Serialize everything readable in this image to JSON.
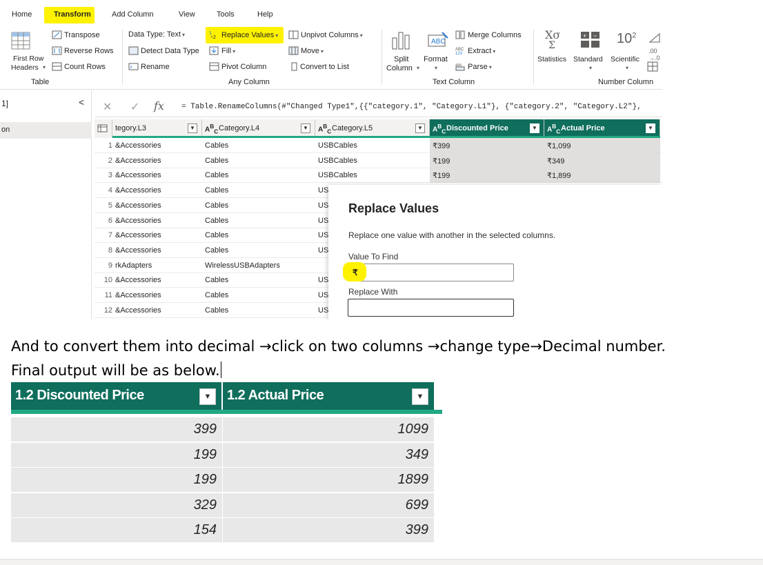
{
  "menu": {
    "home": "Home",
    "transform": "Transform",
    "add_column": "Add Column",
    "view": "View",
    "tools": "Tools",
    "help": "Help"
  },
  "ribbon": {
    "first_row_line1": "First Row",
    "first_row_line2": "Headers",
    "transpose": "Transpose",
    "reverse_rows": "Reverse Rows",
    "count_rows": "Count Rows",
    "data_type": "Data Type: Text",
    "detect_data_type": "Detect Data Type",
    "rename": "Rename",
    "replace_values": "Replace Values",
    "fill": "Fill",
    "pivot_column": "Pivot Column",
    "unpivot_columns": "Unpivot Columns",
    "move": "Move",
    "convert_to_list": "Convert to List",
    "split_line1": "Split",
    "split_line2": "Column",
    "format": "Format",
    "merge_columns": "Merge Columns",
    "extract": "Extract",
    "parse": "Parse",
    "statistics": "Statistics",
    "standard": "Standard",
    "scientific": "Scientific",
    "groups": {
      "table": "Table",
      "any_column": "Any Column",
      "text_column": "Text Column",
      "number_column": "Number Column"
    }
  },
  "queries": {
    "label1": "1]",
    "label2": "on",
    "collapse": "<"
  },
  "formula": {
    "cancel": "✕",
    "commit": "✓",
    "fx": "fx",
    "text": "= Table.RenameColumns(#\"Changed Type1\",{{\"category.1\", \"Category.L1\"}, {\"category.2\", \"Category.L2\"},"
  },
  "grid": {
    "headers": [
      "tegory.L3",
      "Category.L4",
      "Category.L5",
      "Discounted Price",
      "Actual Price"
    ],
    "rows": [
      {
        "n": "1",
        "c3": "&Accessories",
        "c4": "Cables",
        "c5": "USBCables",
        "dp": "₹399",
        "ap": "₹1,099"
      },
      {
        "n": "2",
        "c3": "&Accessories",
        "c4": "Cables",
        "c5": "USBCables",
        "dp": "₹199",
        "ap": "₹349"
      },
      {
        "n": "3",
        "c3": "&Accessories",
        "c4": "Cables",
        "c5": "USBCables",
        "dp": "₹199",
        "ap": "₹1,899"
      },
      {
        "n": "4",
        "c3": "&Accessories",
        "c4": "Cables",
        "c5": "US",
        "dp": "",
        "ap": ""
      },
      {
        "n": "5",
        "c3": "&Accessories",
        "c4": "Cables",
        "c5": "US",
        "dp": "",
        "ap": ""
      },
      {
        "n": "6",
        "c3": "&Accessories",
        "c4": "Cables",
        "c5": "US",
        "dp": "",
        "ap": ""
      },
      {
        "n": "7",
        "c3": "&Accessories",
        "c4": "Cables",
        "c5": "US",
        "dp": "",
        "ap": ""
      },
      {
        "n": "8",
        "c3": "&Accessories",
        "c4": "Cables",
        "c5": "US",
        "dp": "",
        "ap": ""
      },
      {
        "n": "9",
        "c3": "rkAdapters",
        "c4": "WirelessUSBAdapters",
        "c5": "",
        "dp": "",
        "ap": ""
      },
      {
        "n": "10",
        "c3": "&Accessories",
        "c4": "Cables",
        "c5": "US",
        "dp": "",
        "ap": ""
      },
      {
        "n": "11",
        "c3": "&Accessories",
        "c4": "Cables",
        "c5": "US",
        "dp": "",
        "ap": ""
      },
      {
        "n": "12",
        "c3": "&Accessories",
        "c4": "Cables",
        "c5": "US",
        "dp": "",
        "ap": ""
      }
    ]
  },
  "dialog": {
    "title": "Replace Values",
    "description": "Replace one value with another in the selected columns.",
    "find_label": "Value To Find",
    "find_value": "₹",
    "replace_label": "Replace With",
    "replace_value": ""
  },
  "doc": {
    "line1": "And to convert them into decimal →click on two columns →change type→Decimal number.",
    "line2": "Final output will be as below."
  },
  "final_table": {
    "headers": [
      "1.2  Discounted Price",
      "1.2  Actual Price"
    ],
    "rows": [
      {
        "dp": "399",
        "ap": "1099"
      },
      {
        "dp": "199",
        "ap": "349"
      },
      {
        "dp": "199",
        "ap": "1899"
      },
      {
        "dp": "329",
        "ap": "699"
      },
      {
        "dp": "154",
        "ap": "399"
      }
    ]
  },
  "colors": {
    "highlight": "#fff200",
    "header_dark": "#0f6e5c",
    "header_bar": "#22a884"
  }
}
